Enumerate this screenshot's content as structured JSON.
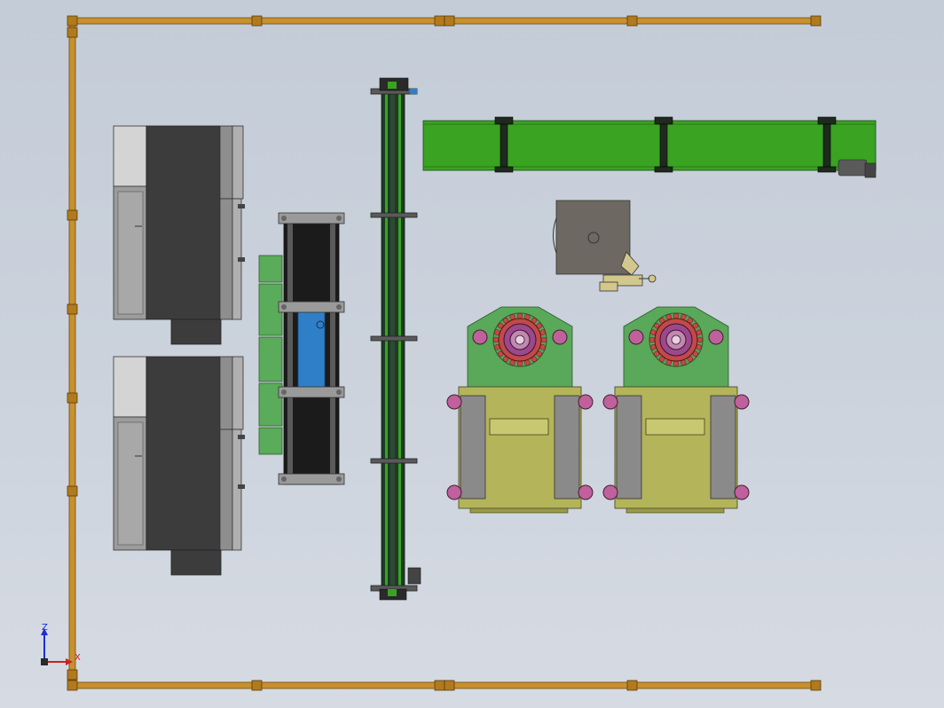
{
  "view": {
    "kind": "CAD top-view assembly layout",
    "background_top": "#c4ccd8",
    "background_bottom": "#d6dbe3"
  },
  "triad": {
    "z_label": "Z",
    "x_label": "X",
    "z_color": "#1a2fd0",
    "x_color": "#d02020"
  },
  "colors": {
    "frame": "#c9902e",
    "frame_joint": "#a36a12",
    "cabinet_dark": "#3c3c3c",
    "cabinet_mid": "#9a9a9a",
    "cabinet_light": "#d0d0d0",
    "conveyor_green": "#3aa321",
    "conveyor_dark": "#1f3a26",
    "panel_green": "#5aab5a",
    "blue_panel": "#2f7fc8",
    "machine_green": "#5aa85a",
    "machine_olive": "#b4b45a",
    "machine_gray": "#8a8a8a",
    "magenta": "#c0609c",
    "gear_red": "#c04a4a",
    "robot_gray": "#6e6862",
    "robot_yellow": "#d2c78c"
  },
  "components": [
    {
      "name": "perimeter-frame",
      "icon": "frame-icon"
    },
    {
      "name": "electrical-cabinet",
      "count": 2,
      "icon": "cabinet-icon"
    },
    {
      "name": "tray-rack",
      "icon": "rack-icon"
    },
    {
      "name": "vertical-chain-conveyor",
      "icon": "conveyor-icon"
    },
    {
      "name": "horizontal-belt-conveyor",
      "icon": "belt-icon"
    },
    {
      "name": "robot-arm",
      "icon": "robot-icon"
    },
    {
      "name": "rotary-press-station",
      "count": 2,
      "icon": "press-icon"
    }
  ]
}
